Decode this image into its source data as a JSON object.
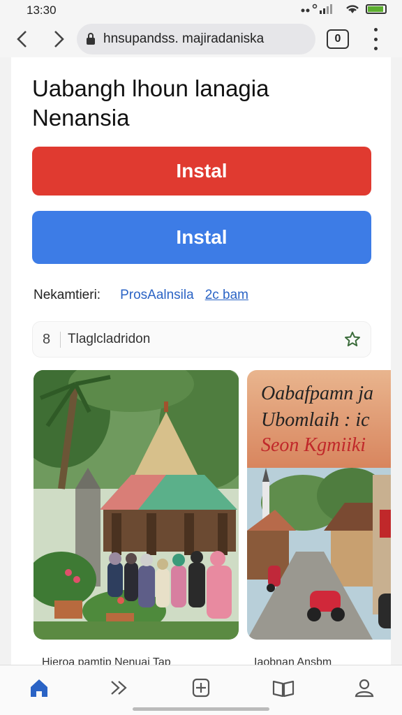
{
  "status_bar": {
    "time": "13:30"
  },
  "browser": {
    "url": "hnsupandss. majiradaniska",
    "tab_count": "0"
  },
  "page": {
    "title": "Uabangh lhoun lanagia Nenansia",
    "primary_button": "Instal",
    "secondary_button": "Instal",
    "meta_label": "Nekamtieri:",
    "meta_link_1": "ProsAalnsila",
    "meta_link_2": "2c bam",
    "search_number": "8",
    "search_text": "Tlaglcladridon",
    "card_2_overlay_line_1": "Oabafpamn ja",
    "card_2_overlay_line_2": "Ubomlaih : ic",
    "card_2_overlay_line_3": "Seon Kgmiiki",
    "caption_1": "Hieroa pamtip Nenuai  Tap",
    "caption_2": "Iaobnan Ansbm"
  },
  "colors": {
    "red_button": "#e03a30",
    "blue_button": "#3d7ce6",
    "link": "#2a63c5",
    "active_nav": "#2a63c5"
  },
  "bottom_nav": {
    "items": [
      "home-icon",
      "forward-icon",
      "add-tab-icon",
      "book-icon",
      "profile-icon"
    ]
  }
}
